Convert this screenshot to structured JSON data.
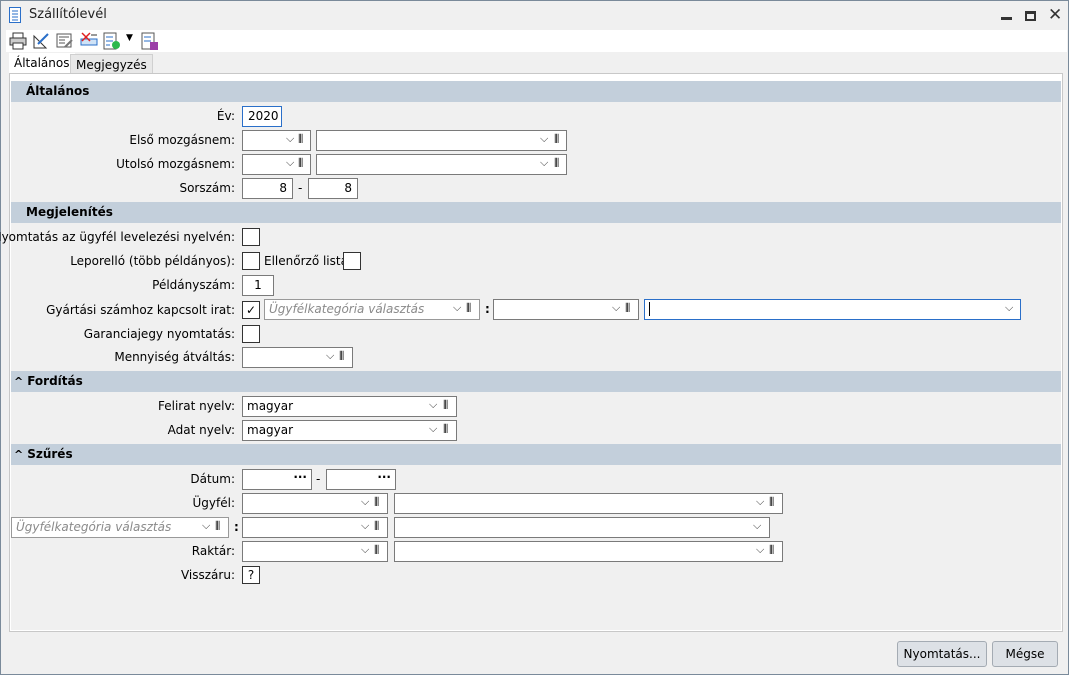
{
  "window": {
    "title": "Szállítólevél"
  },
  "tabs": [
    "Általános",
    "Megjegyzés"
  ],
  "sections": {
    "general": "Általános",
    "display": "Megjelenítés",
    "translation": "Fordítás",
    "filter": "Szűrés"
  },
  "general": {
    "year_label": "Év:",
    "year": "2020",
    "first_label": "Első mozgásnem:",
    "last_label": "Utolsó mozgásnem:",
    "serial_label": "Sorszám:",
    "serial_from": "8",
    "serial_to": "8",
    "dash": "-"
  },
  "display": {
    "client_lang_label": "Nyomtatás az ügyfél levelezési nyelvén:",
    "leporello_label": "Leporelló (több példányos):",
    "checklist_label": "Ellenőrző lista:",
    "copies_label": "Példányszám:",
    "copies": "1",
    "serial_doc_label": "Gyártási számhoz kapcsolt irat:",
    "category_placeholder": "Ügyfélkategória választás",
    "colon": ":",
    "warranty_label": "Garanciajegy nyomtatás:",
    "quantity_label": "Mennyiség átváltás:"
  },
  "translation": {
    "caption_label": "Felirat nyelv:",
    "caption_value": "magyar",
    "data_label": "Adat nyelv:",
    "data_value": "magyar"
  },
  "filter": {
    "date_label": "Dátum:",
    "ellipsis": "···",
    "dash": "-",
    "client_label": "Ügyfél:",
    "category_placeholder": "Ügyfélkategória választás",
    "colon": ":",
    "warehouse_label": "Raktár:",
    "return_label": "Visszáru:",
    "return_value": "?"
  },
  "buttons": {
    "print": "Nyomtatás...",
    "cancel": "Mégse"
  },
  "icons": {
    "chevron": "⌵",
    "clip": "🖇",
    "check": "✓"
  }
}
